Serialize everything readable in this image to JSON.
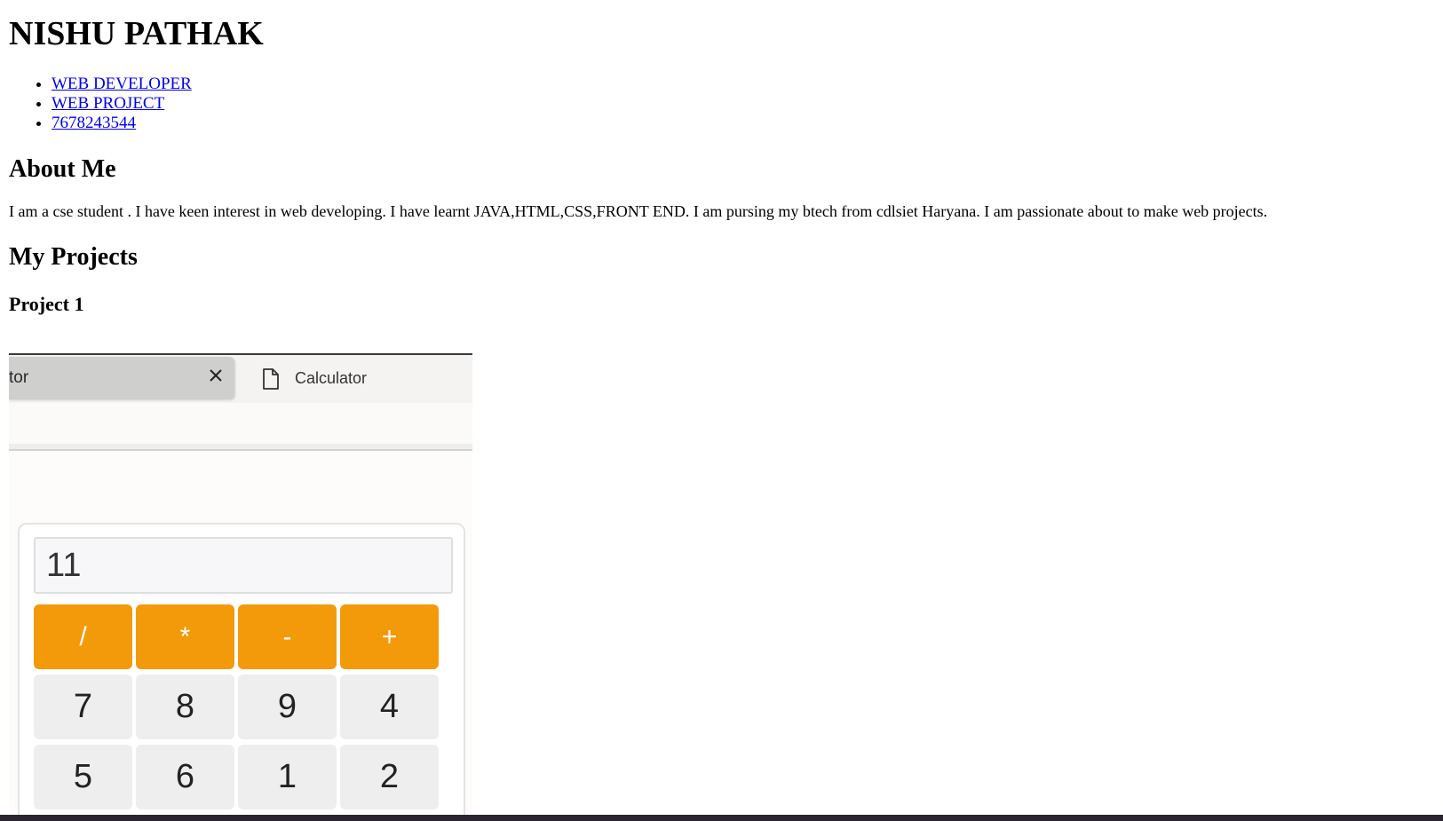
{
  "header": {
    "name": "NISHU PATHAK"
  },
  "nav": {
    "items": [
      {
        "label": "WEB DEVELOPER"
      },
      {
        "label": "WEB PROJECT"
      },
      {
        "label": "7678243544"
      }
    ]
  },
  "about": {
    "heading": "About Me",
    "text": "I am a cse student . I have keen interest in web developing. I have learnt JAVA,HTML,CSS,FRONT END. I am pursing my btech from cdlsiet Haryana. I am passionate about to make web projects."
  },
  "projects": {
    "heading": "My Projects",
    "items": [
      {
        "title": "Project 1"
      }
    ]
  },
  "screenshot": {
    "active_tab_text": "tor",
    "inactive_tab_text": "Calculator",
    "calculator": {
      "display_value": "11",
      "operator_keys": [
        "/",
        "*",
        "-",
        "+"
      ],
      "number_rows": [
        [
          "7",
          "8",
          "9",
          "4"
        ],
        [
          "5",
          "6",
          "1",
          "2"
        ]
      ],
      "operator_color": "#f39a0a",
      "number_key_color": "#eeeeee"
    }
  },
  "icons": {
    "close": "close-icon",
    "document": "document-icon"
  }
}
